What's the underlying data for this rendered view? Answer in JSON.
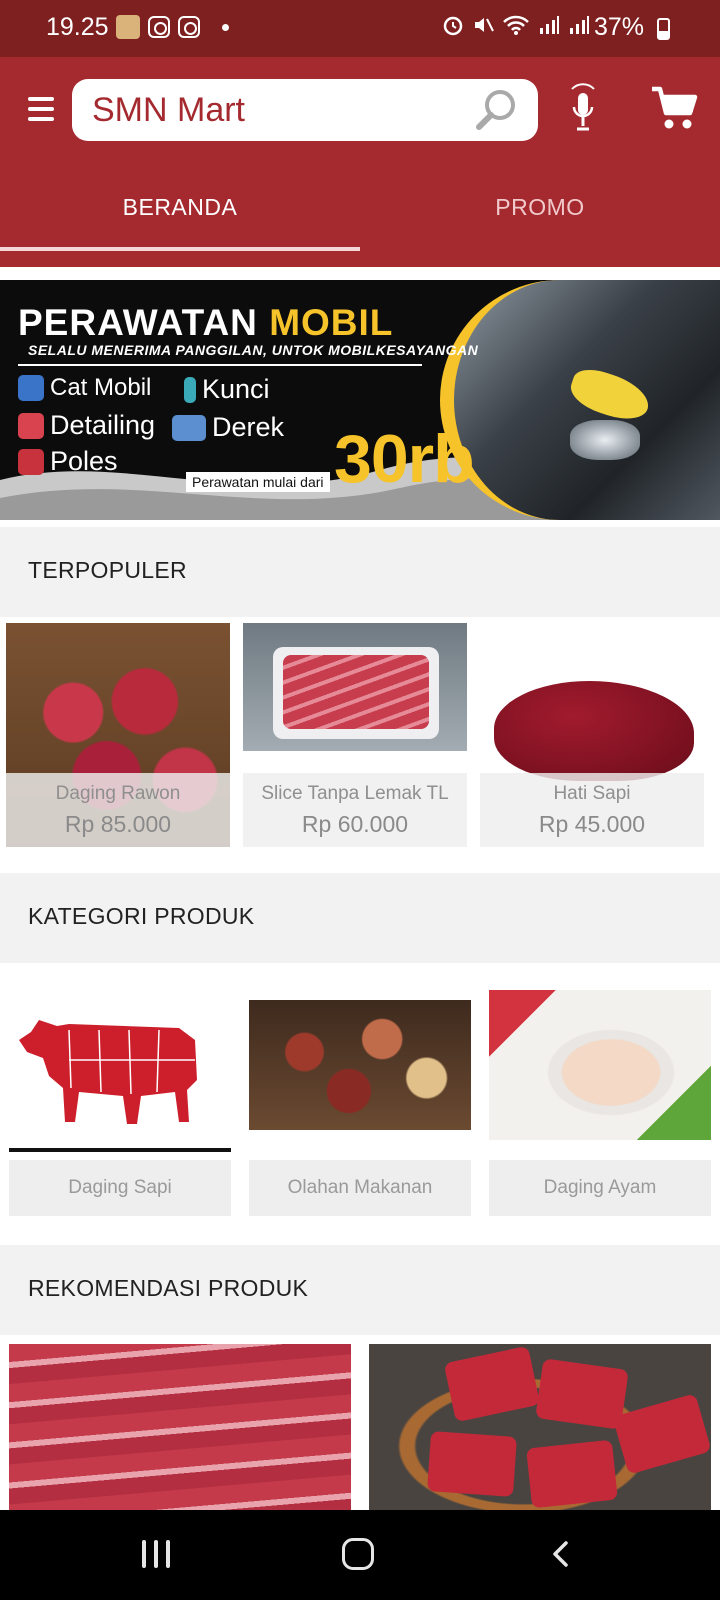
{
  "status_bar": {
    "time": "19.25",
    "battery_percent": "37%",
    "icons": [
      "avatar-icon",
      "instagram-icon",
      "instagram-icon",
      "alarm-icon",
      "mute-icon",
      "wifi-icon",
      "signal-icon",
      "signal-icon",
      "battery-icon"
    ]
  },
  "header": {
    "search_value": "SMN Mart",
    "icons": [
      "menu-icon",
      "search-icon",
      "mic-icon",
      "cart-icon"
    ],
    "colors": {
      "brand": "#a52a2f",
      "status_bar": "#7e2020",
      "accent": "#f6c32a"
    }
  },
  "tabs": [
    {
      "label": "BERANDA",
      "selected": true
    },
    {
      "label": "PROMO",
      "selected": false
    }
  ],
  "banner": {
    "title_part1": "PERAWATAN ",
    "title_part2": "MOBIL",
    "subtitle": "SELALU MENERIMA PANGGILAN, UNTOK MOBILKESAYANGAN",
    "services": [
      "Cat Mobil",
      "Kunci",
      "Detailing",
      "Derek",
      "Poles"
    ],
    "note": "Perawatan mulai dari",
    "price": "30rb"
  },
  "sections": {
    "popular": "TERPOPULER",
    "categories": "KATEGORI PRODUK",
    "recommended": "REKOMENDASI PRODUK"
  },
  "popular_products": [
    {
      "name": "Daging Rawon",
      "price": "Rp 85.000"
    },
    {
      "name": "Slice Tanpa Lemak TL",
      "price": "Rp 60.000"
    },
    {
      "name": "Hati Sapi",
      "price": "Rp 45.000"
    }
  ],
  "categories": [
    {
      "label": "Daging Sapi"
    },
    {
      "label": "Olahan Makanan"
    },
    {
      "label": "Daging Ayam"
    }
  ]
}
